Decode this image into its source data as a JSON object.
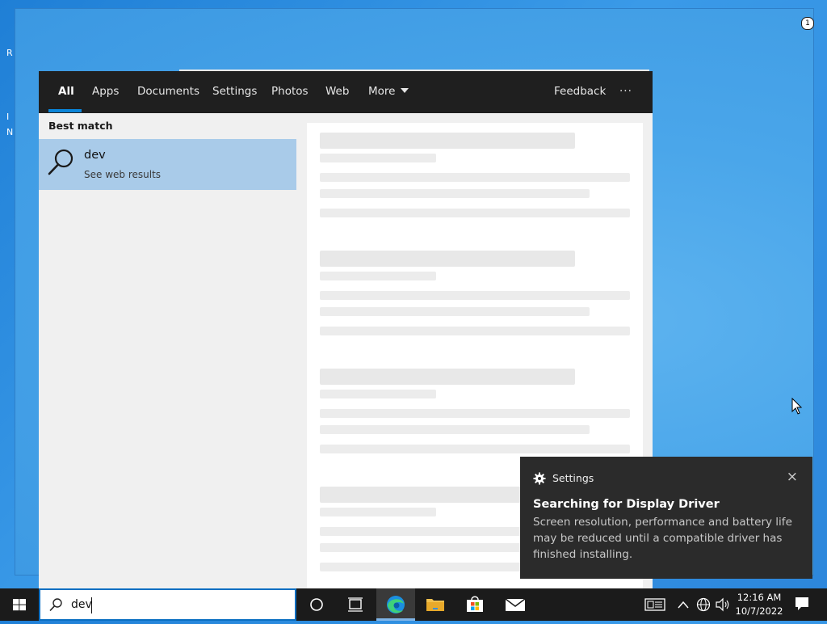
{
  "search": {
    "tabs": [
      {
        "label": "All"
      },
      {
        "label": "Apps"
      },
      {
        "label": "Documents"
      },
      {
        "label": "Settings"
      },
      {
        "label": "Photos"
      },
      {
        "label": "Web"
      },
      {
        "label": "More"
      }
    ],
    "feedback_label": "Feedback",
    "more_options_label": "···",
    "best_match_label": "Best match",
    "best_match": {
      "title": "dev",
      "subtitle": "See web results",
      "icon": "search-icon"
    }
  },
  "notification": {
    "app_name": "Settings",
    "app_icon": "gear-icon",
    "title": "Searching for Display Driver",
    "body": "Screen resolution, performance and battery life may be reduced until a compatible driver has finished installing.",
    "close_label": "×"
  },
  "taskbar": {
    "search_value": "dev",
    "time": "12:16 AM",
    "date": "10/7/2022",
    "notification_count": "1",
    "accent_color": "#0a84d8"
  },
  "desktop": {
    "edge_letters": [
      "R",
      "I",
      "N"
    ]
  }
}
